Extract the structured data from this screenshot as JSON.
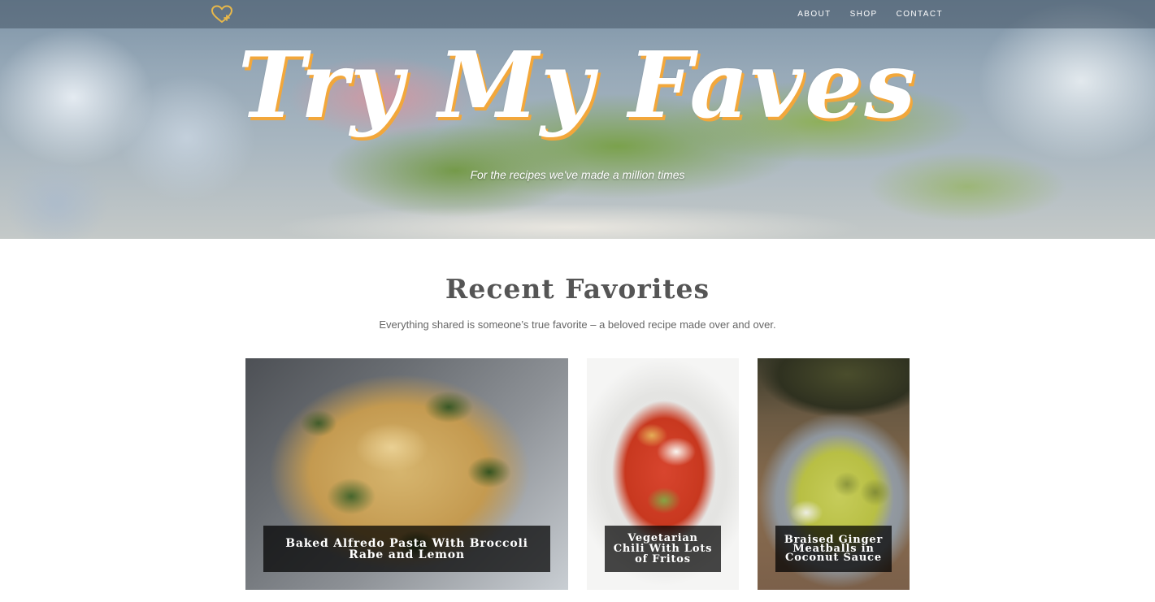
{
  "nav": {
    "logo_icon": "heart-plus-icon",
    "links": [
      "ABOUT",
      "SHOP",
      "CONTACT"
    ]
  },
  "hero": {
    "title": "Try My Faves",
    "subtitle": "For the recipes we've made a million times"
  },
  "recent": {
    "title": "Recent Favorites",
    "subtitle": "Everything shared is someone’s true favorite – a beloved recipe made over and over."
  },
  "cards": [
    {
      "title": "Baked Alfredo Pasta With Broccoli Rabe and Lemon"
    },
    {
      "title": "Vegetarian Chili With Lots of Fritos"
    },
    {
      "title": "Braised Ginger Meatballs in Coconut Sauce"
    }
  ],
  "colors": {
    "accent": "#f2a73b",
    "logo": "#e8b84a",
    "text_heading": "#555555",
    "text_body": "#666666"
  }
}
